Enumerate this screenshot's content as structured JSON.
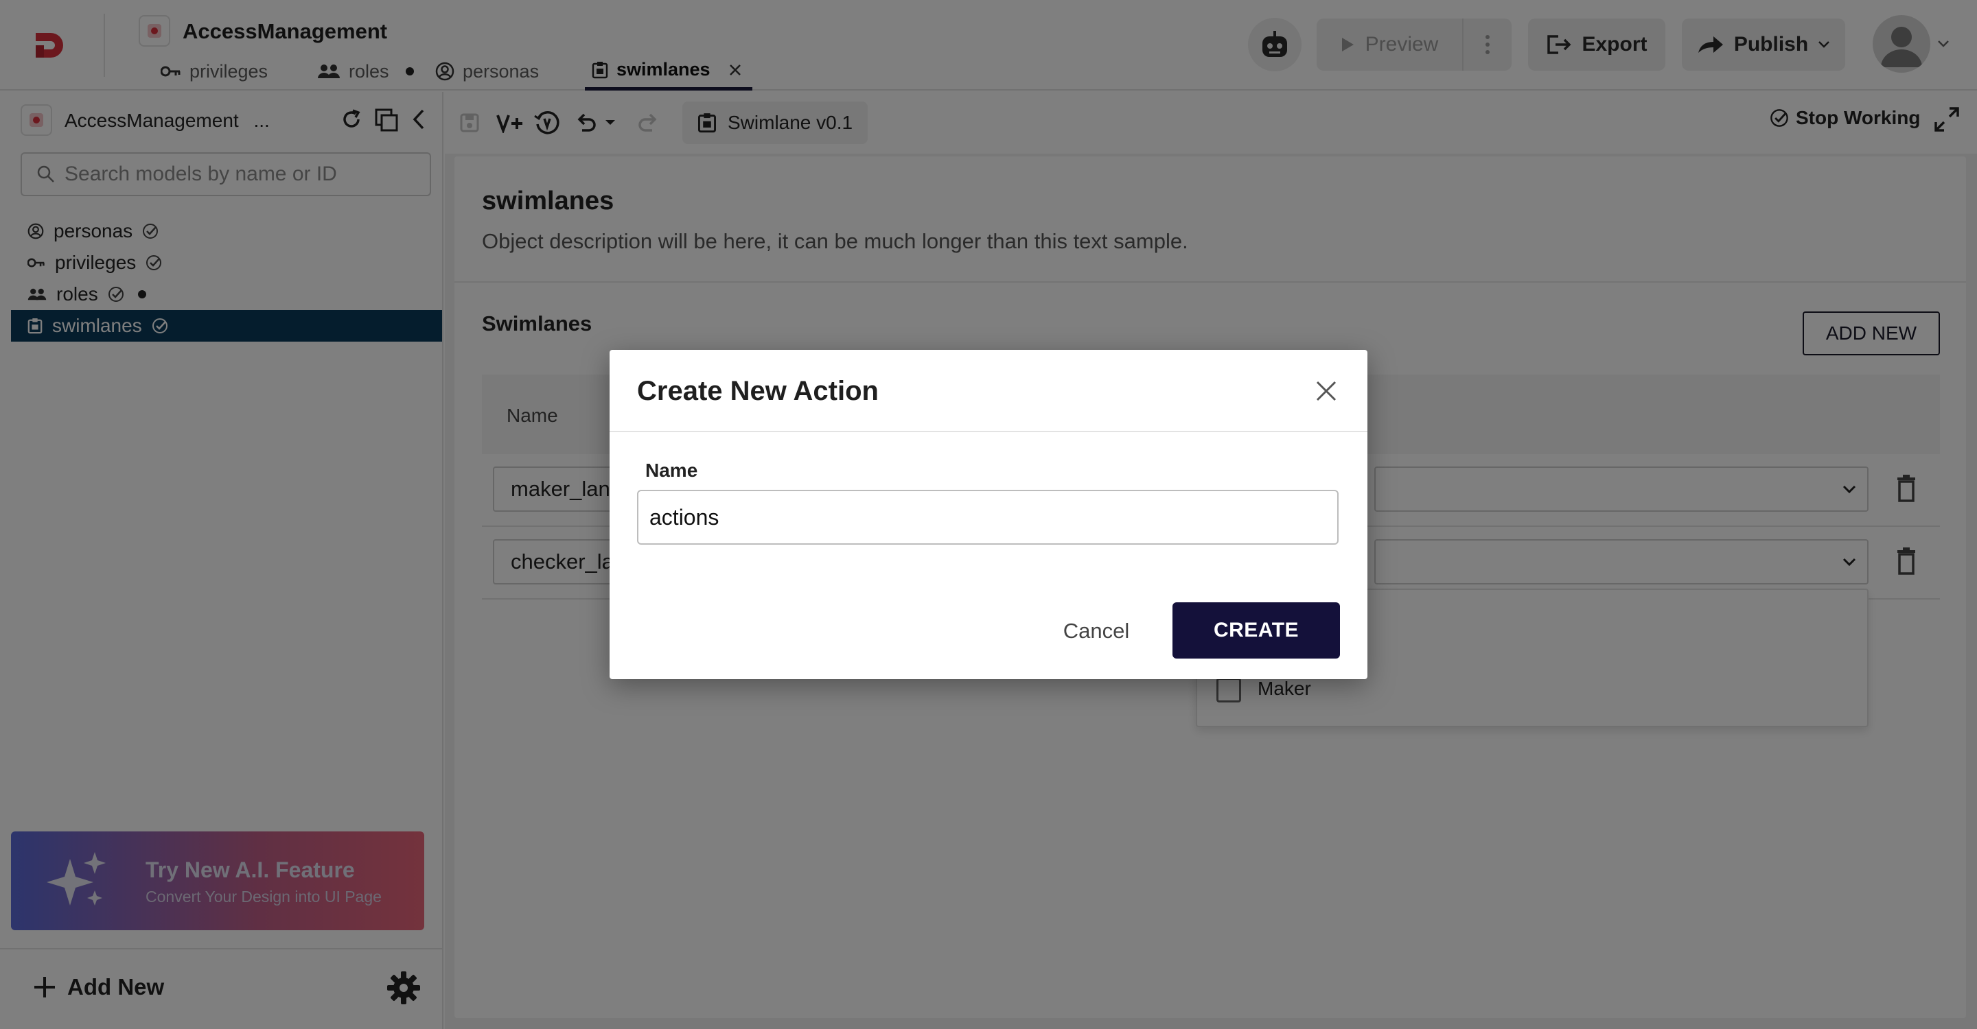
{
  "app": {
    "title": "AccessManagement"
  },
  "tabs": [
    {
      "label": "privileges",
      "icon": "key-icon",
      "active": false
    },
    {
      "label": "roles",
      "icon": "users-icon",
      "active": false,
      "unsaved": true
    },
    {
      "label": "personas",
      "icon": "persona-icon",
      "active": false
    },
    {
      "label": "swimlanes",
      "icon": "swimlane-icon",
      "active": true
    }
  ],
  "header": {
    "preview_label": "Preview",
    "export_label": "Export",
    "publish_label": "Publish"
  },
  "sidebar": {
    "title": "AccessManagement",
    "more": "...",
    "search_placeholder": "Search models by name or ID",
    "items": [
      {
        "label": "personas",
        "icon": "persona-icon",
        "selected": false
      },
      {
        "label": "privileges",
        "icon": "key-icon",
        "selected": false
      },
      {
        "label": "roles",
        "icon": "users-icon",
        "selected": false,
        "unsaved": true
      },
      {
        "label": "swimlanes",
        "icon": "swimlane-icon",
        "selected": true
      }
    ],
    "ai_banner": {
      "title": "Try New A.I. Feature",
      "subtitle": "Convert Your Design into UI Page"
    },
    "add_new_label": "Add New"
  },
  "toolbar": {
    "version_label": "Swimlane v0.1",
    "stop_working_label": "Stop Working"
  },
  "main": {
    "title": "swimlanes",
    "description": "Object description will be here, it can be much longer than this text sample.",
    "section_title": "Swimlanes",
    "add_new_label": "ADD NEW",
    "table": {
      "column_name": "Name",
      "rows": [
        {
          "name": "maker_lane"
        },
        {
          "name": "checker_lane"
        }
      ]
    },
    "dropdown_option": "Maker"
  },
  "modal": {
    "title": "Create New Action",
    "field_label": "Name",
    "field_value": "actions",
    "cancel_label": "Cancel",
    "create_label": "CREATE"
  },
  "colors": {
    "primary_dark": "#14113a",
    "sidebar_selected": "#0b3a5a",
    "brand_red": "#d9303c"
  }
}
